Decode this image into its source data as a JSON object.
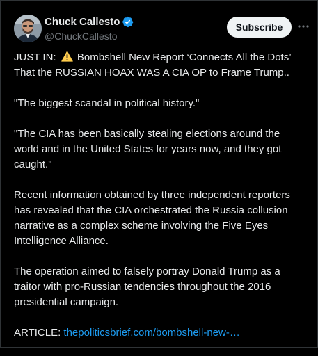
{
  "colors": {
    "background": "#000000",
    "text": "#e7e9ea",
    "secondary": "#71767b",
    "link": "#1d9bf0",
    "verified": "#1d9bf0",
    "subscribe_bg": "#eff3f4",
    "warning": "#ffcc4d"
  },
  "author": {
    "display_name": "Chuck Callesto",
    "handle": "@ChuckCallesto",
    "verified_icon": "verified-badge-icon",
    "avatar_icon": "avatar"
  },
  "header": {
    "subscribe_label": "Subscribe",
    "more_icon": "more-horizontal-icon"
  },
  "post": {
    "line1_prefix": "JUST IN: ",
    "warning_icon": "warning-emoji-icon",
    "line1_suffix": " Bombshell New Report ‘Connects All the Dots’ That the RUSSIAN HOAX WAS A CIA OP to Frame Trump..",
    "p2": "\"The biggest scandal in political history.\"",
    "p3": "\"The CIA has been basically stealing elections around the world and in the United States for years now, and they got caught.\"",
    "p4": "Recent information obtained by three independent reporters has revealed that the CIA orchestrated the Russia collusion narrative as a complex scheme involving the Five Eyes Intelligence Alliance.",
    "p5": "The operation aimed to falsely portray Donald Trump as a traitor with pro-Russian tendencies throughout the 2016 presidential campaign.",
    "article_label": "ARTICLE: ",
    "article_link": "thepoliticsbrief.com/bombshell-new-…"
  }
}
